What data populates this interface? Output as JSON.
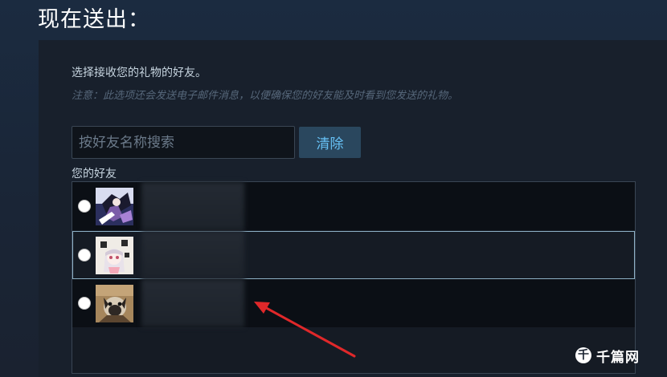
{
  "header": {
    "title": "现在送出："
  },
  "panel": {
    "instruction": "选择接收您的礼物的好友。",
    "note": "注意：此选项还会发送电子邮件消息，以便确保您的好友能及时看到您发送的礼物。"
  },
  "search": {
    "placeholder": "按好友名称搜索",
    "value": "",
    "clear_label": "清除"
  },
  "friends": {
    "label": "您的好友",
    "items": [
      {
        "name": "",
        "selected": false,
        "avatar": "anime-character-purple"
      },
      {
        "name": "",
        "selected": false,
        "highlighted": true,
        "avatar": "anime-character-white-hair"
      },
      {
        "name": "",
        "selected": false,
        "avatar": "pug-dog"
      }
    ]
  },
  "annotation": {
    "arrow_color": "#e0282a"
  },
  "watermark": {
    "logo": "千",
    "text": "千篇网"
  },
  "colors": {
    "background": "#1b2838",
    "panel": "#18202c",
    "accent": "#66c0f4",
    "button_bg": "#2a475e",
    "text": "#c6d4df",
    "note_text": "#56677a"
  }
}
